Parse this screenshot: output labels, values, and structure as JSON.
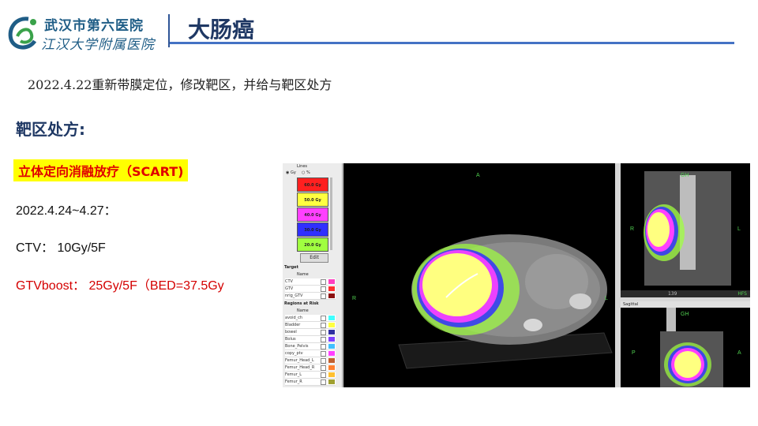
{
  "header": {
    "logo_line1": "武汉市第六医院",
    "logo_line2": "江汉大学附属医院",
    "title": "大肠癌"
  },
  "content": {
    "note": "2022.4.22重新带膜定位，修改靶区，并给与靶区处方",
    "heading": "靶区处方:",
    "technique": "立体定向消融放疗（SCART)",
    "date_range": "2022.4.24~4.27：",
    "ctv": "CTV： 10Gy/5F",
    "gtv_boost": "GTVboost： 25Gy/5F（BED=37.5Gy"
  },
  "tps": {
    "lines_label": "Lines",
    "unit_gy": "Gy",
    "unit_pct": "%",
    "dose_levels": [
      {
        "label": "60.0 Gy",
        "color": "#ff2020"
      },
      {
        "label": "50.0 Gy",
        "color": "#ffff40"
      },
      {
        "label": "40.0 Gy",
        "color": "#ff40ff"
      },
      {
        "label": "30.0 Gy",
        "color": "#3030ff"
      },
      {
        "label": "20.0 Gy",
        "color": "#a0ff40"
      }
    ],
    "edit_label": "Edit",
    "target_label": "Target",
    "name_label": "Name",
    "targets": [
      {
        "name": "CTV",
        "color": "#ff40c0"
      },
      {
        "name": "GTV",
        "color": "#ff3030"
      },
      {
        "name": "nrig_GTV",
        "color": "#8b1010"
      }
    ],
    "oar_label": "Regions at Risk",
    "oars": [
      {
        "name": "avoid_ch",
        "color": "#40ffff"
      },
      {
        "name": "Bladder",
        "color": "#ffff40"
      },
      {
        "name": "bowel",
        "color": "#3030a0"
      },
      {
        "name": "Bolus",
        "color": "#8040ff"
      },
      {
        "name": "Bone_Pelvis",
        "color": "#40c0ff"
      },
      {
        "name": "copy_ptv",
        "color": "#ff40ff"
      },
      {
        "name": "Femur_Head_L",
        "color": "#c06030"
      },
      {
        "name": "Femur_Head_R",
        "color": "#ff8030"
      },
      {
        "name": "Femur_L",
        "color": "#ffc030"
      },
      {
        "name": "Femur_R",
        "color": "#a0a030"
      }
    ],
    "axial_top": "A",
    "axial_left": "R",
    "axial_right": "L",
    "coronal_top": "GH",
    "coronal_left": "R",
    "coronal_right": "L",
    "coronal_slice": "139",
    "coronal_pos": "HFS",
    "sagittal_label": "Sagittal",
    "sagittal_top": "GH",
    "sagittal_left": "P",
    "sagittal_right": "A"
  }
}
